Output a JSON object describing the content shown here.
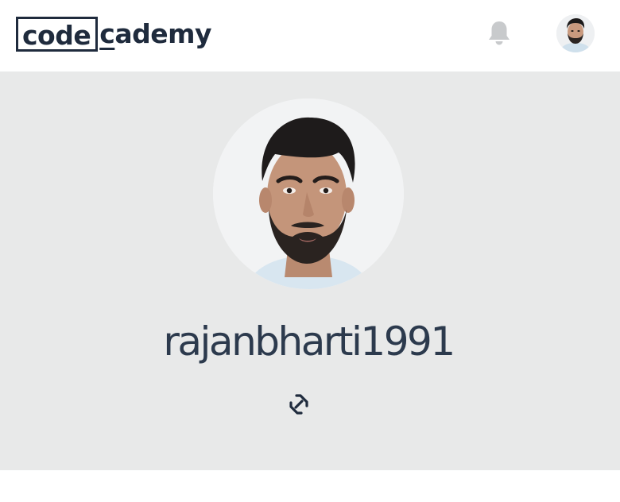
{
  "header": {
    "logo_boxed": "code",
    "logo_rest_underlined": "c",
    "logo_rest": "ademy",
    "notifications_icon": "bell-icon",
    "user_avatar_icon": "user-avatar"
  },
  "profile": {
    "username": "rajanbharti1991",
    "link_icon": "link-icon"
  },
  "colors": {
    "brand_navy": "#1f2b3d",
    "hero_bg": "#e8e9e9",
    "bell_gray": "#c8cacc"
  }
}
